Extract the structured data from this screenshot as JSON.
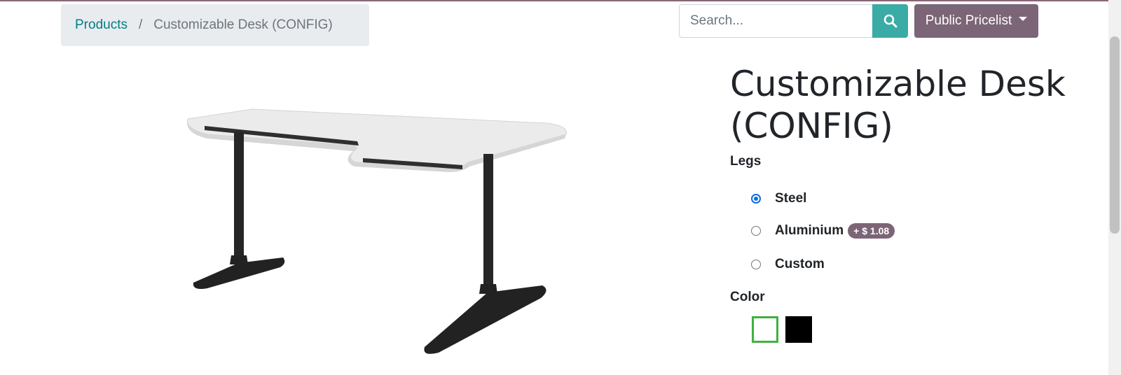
{
  "breadcrumb": {
    "parent": "Products",
    "separator": "/",
    "current": "Customizable Desk (CONFIG)"
  },
  "search": {
    "placeholder": "Search...",
    "icon": "search-icon"
  },
  "pricelist": {
    "label": "Public Pricelist"
  },
  "product": {
    "title": "Customizable Desk (CONFIG)",
    "image": "desk-image"
  },
  "attributes": {
    "legs": {
      "label": "Legs",
      "options": [
        {
          "label": "Steel",
          "selected": true,
          "price_extra": ""
        },
        {
          "label": "Aluminium",
          "selected": false,
          "price_extra": "+ $ 1.08"
        },
        {
          "label": "Custom",
          "selected": false,
          "price_extra": ""
        }
      ]
    },
    "color": {
      "label": "Color",
      "swatches": [
        {
          "color": "#ffffff",
          "selected": true
        },
        {
          "color": "#000000",
          "selected": false
        }
      ]
    }
  },
  "colors": {
    "primary": "#017e84",
    "search_button": "#3aaba5",
    "pricelist_button": "#7c6577",
    "selected_swatch_border": "#3fb23f",
    "radio_checked": "#0b6fe0"
  }
}
